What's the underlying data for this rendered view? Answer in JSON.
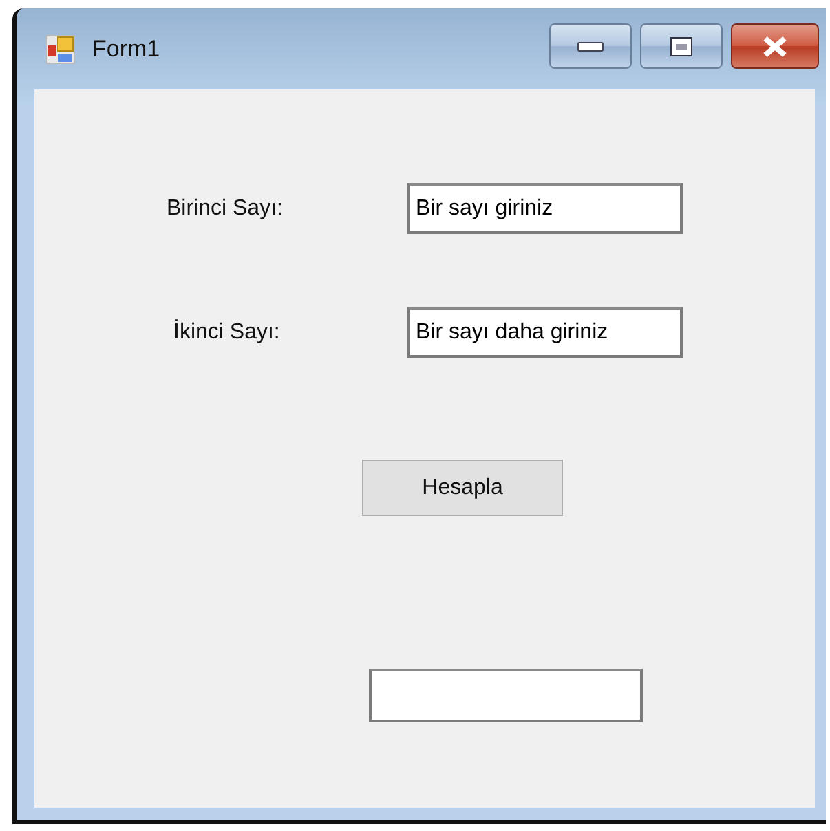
{
  "window": {
    "title": "Form1"
  },
  "fields": [
    {
      "label": "Birinci Sayı:",
      "value": "Bir sayı giriniz"
    },
    {
      "label": "İkinci Sayı:",
      "value": "Bir sayı daha giriniz"
    }
  ],
  "button": {
    "label": "Hesapla"
  }
}
